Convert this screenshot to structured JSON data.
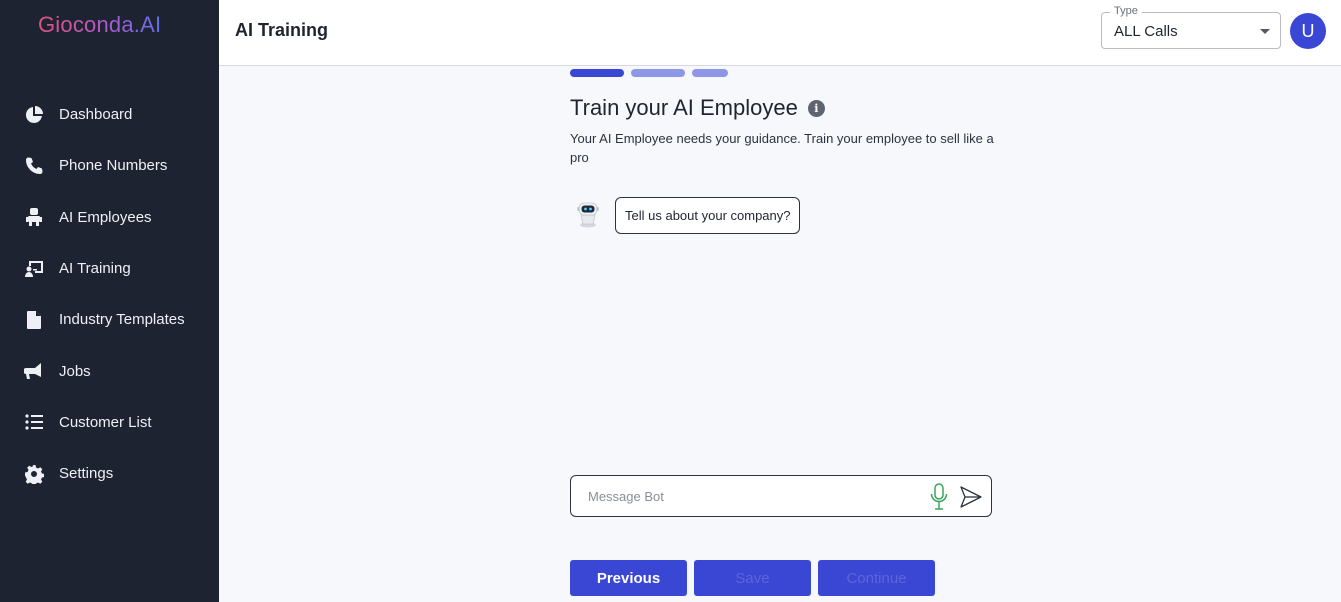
{
  "brand": {
    "logo_text": "Gioconda.AI"
  },
  "sidebar": {
    "items": [
      {
        "label": "Dashboard",
        "icon": "pie-chart-icon"
      },
      {
        "label": "Phone Numbers",
        "icon": "phone-icon"
      },
      {
        "label": "AI Employees",
        "icon": "robot-icon"
      },
      {
        "label": "AI Training",
        "icon": "presentation-icon"
      },
      {
        "label": "Industry Templates",
        "icon": "file-icon"
      },
      {
        "label": "Jobs",
        "icon": "megaphone-icon"
      },
      {
        "label": "Customer List",
        "icon": "list-icon"
      },
      {
        "label": "Settings",
        "icon": "gear-icon"
      }
    ]
  },
  "header": {
    "title": "AI Training",
    "type_select": {
      "label": "Type",
      "value": "ALL Calls"
    },
    "avatar_initial": "U"
  },
  "main": {
    "progress": {
      "total_steps": 3,
      "current_step": 1
    },
    "title": "Train your AI Employee",
    "subtitle": "Your AI Employee needs your guidance. Train your employee to sell like a pro",
    "chat": {
      "messages": [
        {
          "sender": "bot",
          "text": "Tell us about your company?"
        }
      ],
      "input_placeholder": "Message Bot"
    },
    "buttons": {
      "previous": "Previous",
      "save": "Save",
      "continue": "Continue"
    }
  },
  "colors": {
    "sidebar_bg": "#1e2331",
    "accent": "#3a47d5",
    "progress_inactive": "#8e96e6",
    "mic": "#3aa55a"
  }
}
